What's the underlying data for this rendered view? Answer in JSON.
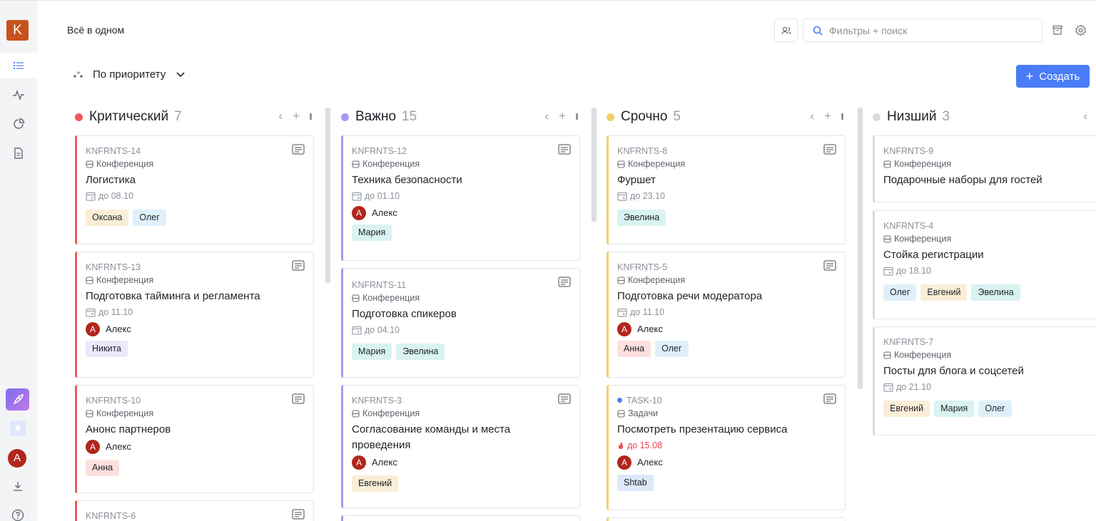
{
  "workspace": {
    "logo_letter": "K",
    "title": "Всё в одном"
  },
  "sidebar": {
    "user_initial": "A",
    "icons": [
      "list-icon",
      "activity-icon",
      "chart-icon",
      "document-icon",
      "rocket-icon",
      "bell-icon",
      "download-icon",
      "help-icon"
    ]
  },
  "header": {
    "search_placeholder": "Фильтры + поиск",
    "group_by_label": "По приоритету",
    "create_label": "Создать"
  },
  "colors": {
    "accent": "#4a7cf7",
    "critical": "#ee5a5a",
    "important": "#a39af3",
    "urgent": "#f3ce6c",
    "lowest": "#d8dadd"
  },
  "columns": [
    {
      "title": "Критический",
      "count": "7",
      "cards": [
        {
          "id": "KNFRNTS-14",
          "project": "Конференция",
          "title": "Логистика",
          "due": "до 08.10",
          "tags": [
            "Оксана",
            "Олег"
          ]
        },
        {
          "id": "KNFRNTS-13",
          "project": "Конференция",
          "title": "Подготовка тайминга и регламента",
          "due": "до 11.10",
          "assignee": "Алекс",
          "tags": [
            "Никита"
          ]
        },
        {
          "id": "KNFRNTS-10",
          "project": "Конференция",
          "title": "Анонс партнеров",
          "assignee": "Алекс",
          "tags": [
            "Анна"
          ]
        },
        {
          "id": "KNFRNTS-6"
        }
      ]
    },
    {
      "title": "Важно",
      "count": "15",
      "cards": [
        {
          "id": "KNFRNTS-12",
          "project": "Конференция",
          "title": "Техника безопасности",
          "due": "до 01.10",
          "assignee": "Алекс",
          "tags": [
            "Мария"
          ]
        },
        {
          "id": "KNFRNTS-11",
          "project": "Конференция",
          "title": "Подготовка спикеров",
          "due": "до 04.10",
          "tags": [
            "Мария",
            "Эвелина"
          ]
        },
        {
          "id": "KNFRNTS-3",
          "project": "Конференция",
          "title": "Согласование команды и места проведения",
          "assignee": "Алекс",
          "tags": [
            "Евгений"
          ]
        }
      ]
    },
    {
      "title": "Срочно",
      "count": "5",
      "cards": [
        {
          "id": "KNFRNTS-8",
          "project": "Конференция",
          "title": "Фуршет",
          "due": "до 23.10",
          "tags": [
            "Эвелина"
          ]
        },
        {
          "id": "KNFRNTS-5",
          "project": "Конференция",
          "title": "Подготовка речи модератора",
          "due": "до 11.10",
          "assignee": "Алекс",
          "tags": [
            "Анна",
            "Олег"
          ]
        },
        {
          "id": "TASK-10",
          "project": "Задачи",
          "title": "Посмотреть презентацию сервиса",
          "due": "до 15.08",
          "assignee": "Алекс",
          "tags": [
            "Shtab"
          ]
        }
      ]
    },
    {
      "title": "Низший",
      "count": "3",
      "cards": [
        {
          "id": "KNFRNTS-9",
          "project": "Конференция",
          "title": "Подарочные наборы для гостей"
        },
        {
          "id": "KNFRNTS-4",
          "project": "Конференция",
          "title": "Стойка регистрации",
          "due": "до 18.10",
          "tags": [
            "Олег",
            "Евгений",
            "Эвелина"
          ]
        },
        {
          "id": "KNFRNTS-7",
          "project": "Конференция",
          "title": "Посты для блога и соцсетей",
          "due": "до 21.10",
          "tags": [
            "Евгений",
            "Мария",
            "Олег"
          ]
        }
      ]
    }
  ]
}
